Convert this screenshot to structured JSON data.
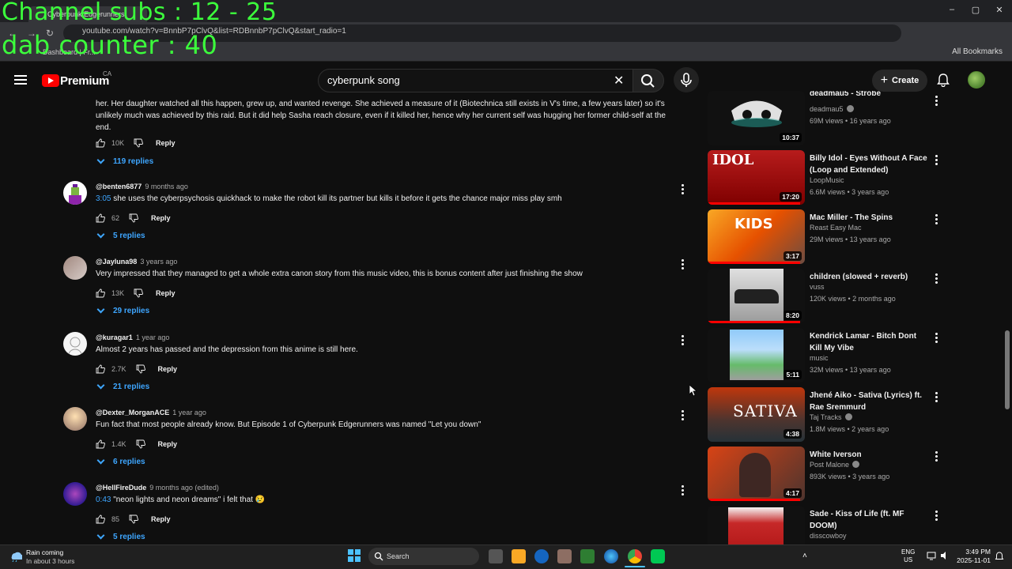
{
  "overlay": {
    "line1": "Channel subs : 12 - 25",
    "line2": "dab counter : 40"
  },
  "browser": {
    "tab_title": "Cyberpunk Edgerunners",
    "url": "youtube.com/watch?v=BnnbP7pClvQ&list=RDBnnbP7pClvQ&start_radio=1",
    "bookmark_item": "Dashboard | Fr...",
    "all_bookmarks": "All Bookmarks"
  },
  "header": {
    "brand": "Premium",
    "country": "CA",
    "search_value": "cyberpunk song",
    "create_label": "Create"
  },
  "top_comment": {
    "text": "her. Her daughter watched all this happen, grew up, and wanted revenge. She achieved a measure of it (Biotechnica still exists in V's time, a few years later) so it's unlikely much was achieved by this raid. But it did help Sasha reach closure, even if it killed her, hence why her current self was hugging her former child-self at the end.",
    "likes": "10K",
    "reply_label": "Reply",
    "replies": "119 replies"
  },
  "comments": [
    {
      "user": "@benten6877",
      "time": "9 months ago",
      "timestamp": "3:05",
      "text": " she uses the cyberpsychosis quickhack to make the robot kill its partner but kills it before it gets the chance major miss play smh",
      "likes": "62",
      "reply_label": "Reply",
      "replies": "5 replies"
    },
    {
      "user": "@Jayluna98",
      "time": "3 years ago",
      "timestamp": "",
      "text": "Very impressed that they managed to get a whole extra canon story from this music video, this is bonus content after just finishing the show",
      "likes": "13K",
      "reply_label": "Reply",
      "replies": "29 replies"
    },
    {
      "user": "@kuragar1",
      "time": "1 year ago",
      "timestamp": "",
      "text": "Almost 2 years has passed and the depression from this anime is still here.",
      "likes": "2.7K",
      "reply_label": "Reply",
      "replies": "21 replies"
    },
    {
      "user": "@Dexter_MorganACE",
      "time": "1 year ago",
      "timestamp": "",
      "text": "Fun fact that most people already know. But Episode 1 of Cyberpunk Edgerunners was named \"Let you down\"",
      "likes": "1.4K",
      "reply_label": "Reply",
      "replies": "6 replies"
    },
    {
      "user": "@HellFireDude",
      "time": "9 months ago (edited)",
      "timestamp": "0:43",
      "text": " \"neon lights and neon dreams\" i felt that 😢",
      "likes": "85",
      "reply_label": "Reply",
      "replies": "5 replies"
    }
  ],
  "recommendations": [
    {
      "title": "deadmau5 - Strobe",
      "channel": "deadmau5",
      "verified": true,
      "meta": "69M views • 16 years ago",
      "duration": "10:37",
      "progress": 0
    },
    {
      "title": "Billy Idol - Eyes Without A Face (Loop and Extended)",
      "channel": "LoopMusic",
      "verified": false,
      "meta": "6.6M views • 3 years ago",
      "duration": "17:20",
      "progress": 0.95
    },
    {
      "title": "Mac Miller - The Spins",
      "channel": "Reast Easy Mac",
      "verified": false,
      "meta": "29M views • 13 years ago",
      "duration": "3:17",
      "progress": 0.95
    },
    {
      "title": "children (slowed + reverb)",
      "channel": "vuss",
      "verified": false,
      "meta": "120K views • 2 months ago",
      "duration": "8:20",
      "progress": 0.95
    },
    {
      "title": "Kendrick Lamar - Bitch Dont Kill My Vibe",
      "channel": "music",
      "verified": false,
      "meta": "32M views • 13 years ago",
      "duration": "5:11",
      "progress": 0
    },
    {
      "title": "Jhené Aiko - Sativa (Lyrics) ft. Rae Sremmurd",
      "channel": "Taj Tracks",
      "verified": true,
      "meta": "1.8M views • 2 years ago",
      "duration": "4:38",
      "progress": 0
    },
    {
      "title": "White Iverson",
      "channel": "Post Malone",
      "verified": true,
      "meta": "893K views • 3 years ago",
      "duration": "4:17",
      "progress": 0.95
    },
    {
      "title": "Sade - Kiss of Life (ft. MF DOOM)",
      "channel": "disscowboy",
      "verified": false,
      "meta": "",
      "duration": "",
      "progress": 0
    }
  ],
  "taskbar": {
    "weather_title": "Rain coming",
    "weather_sub": "In about 3 hours",
    "search_placeholder": "Search",
    "lang_line1": "ENG",
    "lang_line2": "US",
    "time": "3:49 PM",
    "date": "2025-11-01"
  },
  "colors": {
    "accent_blue": "#3ea6ff",
    "overlay_green": "#3cff3c",
    "yt_red": "#ff0000"
  }
}
